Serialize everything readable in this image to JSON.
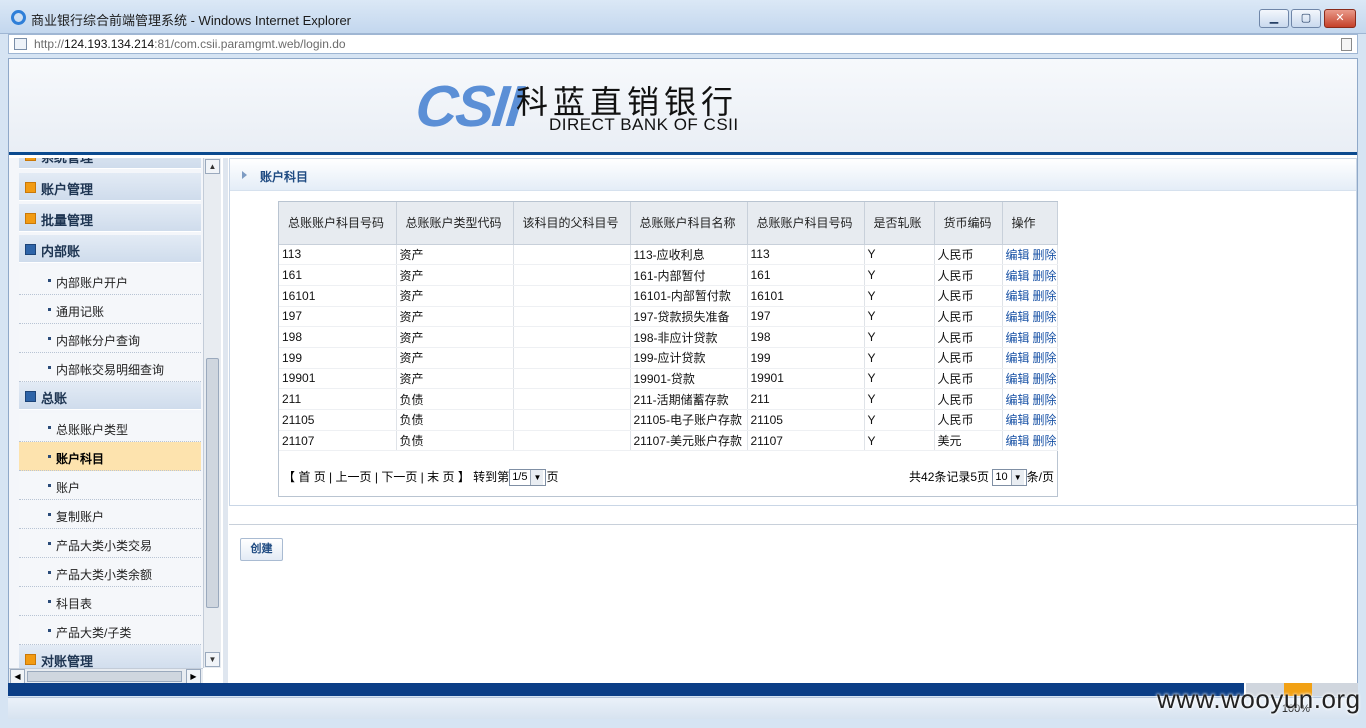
{
  "window": {
    "title": "商业银行综合前端管理系统 - Windows Internet Explorer",
    "min": "▁",
    "max": "▢",
    "close": "✕"
  },
  "address": {
    "prefix": "http://",
    "host": "124.193.134.214",
    "rest": ":81/com.csii.paramgmt.web/login.do"
  },
  "banner": {
    "logo_mark": "CSII",
    "name_cn": "科蓝直销银行",
    "name_en": "DIRECT BANK OF CSII"
  },
  "sidebar": {
    "top_cut": "系统管理",
    "items": [
      {
        "type": "group",
        "label": "账户管理",
        "icon": "orange"
      },
      {
        "type": "group",
        "label": "批量管理",
        "icon": "orange"
      },
      {
        "type": "group",
        "label": "内部账",
        "icon": "blue"
      },
      {
        "type": "sub",
        "label": "内部账户开户"
      },
      {
        "type": "sub",
        "label": "通用记账"
      },
      {
        "type": "sub",
        "label": "内部帐分户查询"
      },
      {
        "type": "sub",
        "label": "内部帐交易明细查询"
      },
      {
        "type": "group",
        "label": "总账",
        "icon": "blue"
      },
      {
        "type": "sub",
        "label": "总账账户类型"
      },
      {
        "type": "sub",
        "label": "账户科目",
        "active": true
      },
      {
        "type": "sub",
        "label": "账户"
      },
      {
        "type": "sub",
        "label": "复制账户"
      },
      {
        "type": "sub",
        "label": "产品大类小类交易"
      },
      {
        "type": "sub",
        "label": "产品大类小类余额"
      },
      {
        "type": "sub",
        "label": "科目表"
      },
      {
        "type": "sub",
        "label": "产品大类/子类"
      },
      {
        "type": "group",
        "label": "对账管理",
        "icon": "orange"
      }
    ]
  },
  "panel": {
    "title": "账户科目"
  },
  "table": {
    "headers": [
      "总账账户科目号码",
      "总账账户类型代码",
      "该科目的父科目号",
      "总账账户科目名称",
      "总账账户科目号码",
      "是否轧账",
      "货币编码",
      "操作"
    ],
    "edit_label": "编辑",
    "delete_label": "删除",
    "rows": [
      [
        "113",
        "资产",
        "",
        "113-应收利息",
        "113",
        "Y",
        "人民币"
      ],
      [
        "161",
        "资产",
        "",
        "161-内部暂付",
        "161",
        "Y",
        "人民币"
      ],
      [
        "16101",
        "资产",
        "",
        "16101-内部暂付款",
        "16101",
        "Y",
        "人民币"
      ],
      [
        "197",
        "资产",
        "",
        "197-贷款损失准备",
        "197",
        "Y",
        "人民币"
      ],
      [
        "198",
        "资产",
        "",
        "198-非应计贷款",
        "198",
        "Y",
        "人民币"
      ],
      [
        "199",
        "资产",
        "",
        "199-应计贷款",
        "199",
        "Y",
        "人民币"
      ],
      [
        "19901",
        "资产",
        "",
        "19901-贷款",
        "19901",
        "Y",
        "人民币"
      ],
      [
        "211",
        "负债",
        "",
        "211-活期储蓄存款",
        "211",
        "Y",
        "人民币"
      ],
      [
        "21105",
        "负债",
        "",
        "21105-电子账户存款",
        "21105",
        "Y",
        "人民币"
      ],
      [
        "21107",
        "负债",
        "",
        "21107-美元账户存款",
        "21107",
        "Y",
        "美元"
      ]
    ]
  },
  "pager": {
    "open": "【",
    "first": "首 页",
    "prev": "上一页",
    "next": "下一页",
    "last": "末 页",
    "close": "】",
    "goto": "转到第",
    "page_value": "1/5",
    "page_suffix": "页",
    "summary": "共42条记录5页",
    "size_value": "10",
    "size_suffix": "条/页"
  },
  "actions": {
    "create": "创建"
  },
  "status": {
    "zoom": "100%",
    "watermark": "www.wooyun.org"
  }
}
